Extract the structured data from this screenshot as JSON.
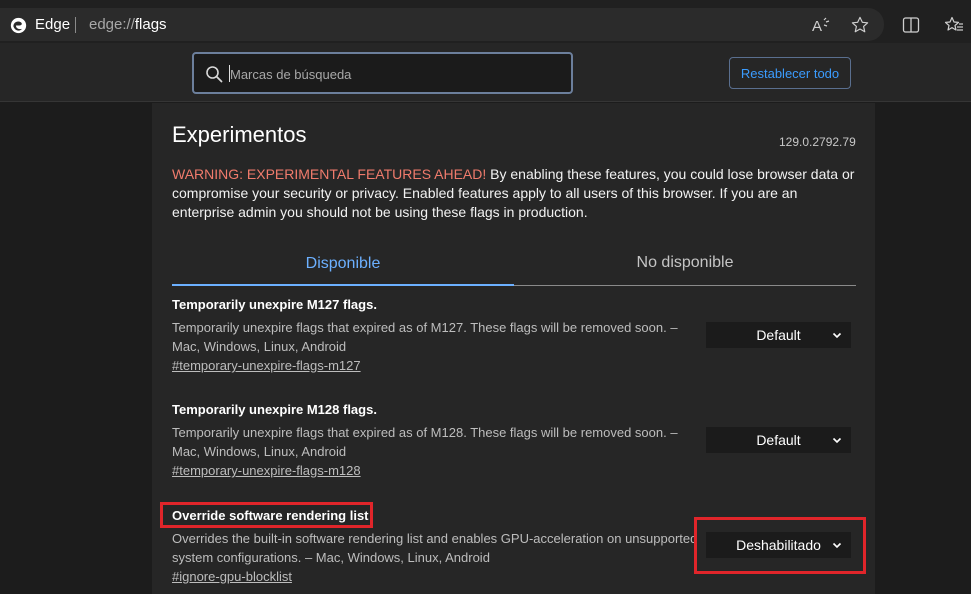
{
  "browser": {
    "app_name": "Edge",
    "url_scheme": "edge://",
    "url_path": "flags"
  },
  "toolbar": {
    "read_aloud_icon": "read-aloud-icon",
    "favorite_icon": "star-icon",
    "split_screen_icon": "split-screen-icon",
    "favorites_icon": "favorites-icon"
  },
  "search": {
    "placeholder": "Marcas de búsqueda",
    "value": ""
  },
  "reset_button": {
    "label": "Restablecer todo"
  },
  "page": {
    "title": "Experimentos",
    "version": "129.0.2792.79",
    "warning_head": "WARNING: EXPERIMENTAL FEATURES AHEAD!",
    "warning_body": " By enabling these features, you could lose browser data or compromise your security or privacy. Enabled features apply to all users of this browser. If you are an enterprise admin you should not be using these flags in production."
  },
  "tabs": [
    {
      "label": "Disponible",
      "active": true
    },
    {
      "label": "No disponible",
      "active": false
    }
  ],
  "flags": [
    {
      "title": "Temporarily unexpire M127 flags.",
      "description": "Temporarily unexpire flags that expired as of M127. These flags will be removed soon. – Mac, Windows, Linux, Android",
      "link": "#temporary-unexpire-flags-m127",
      "value": "Default"
    },
    {
      "title": "Temporarily unexpire M128 flags.",
      "description": "Temporarily unexpire flags that expired as of M128. These flags will be removed soon. – Mac, Windows, Linux, Android",
      "link": "#temporary-unexpire-flags-m128",
      "value": "Default"
    },
    {
      "title": "Override software rendering list",
      "description": "Overrides the built-in software rendering list and enables GPU-acceleration on unsupported system configurations. – Mac, Windows, Linux, Android",
      "link": "#ignore-gpu-blocklist",
      "value": "Deshabilitado"
    }
  ],
  "colors": {
    "accent": "#6cb0ff",
    "link_button": "#3b9cff",
    "warning": "#f07b6c",
    "highlight": "#e0252a"
  }
}
